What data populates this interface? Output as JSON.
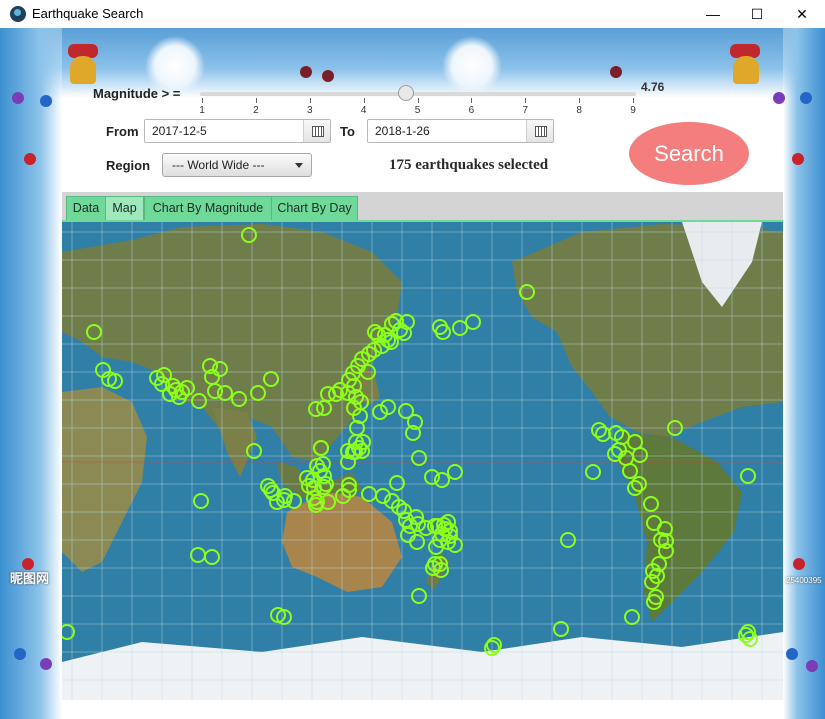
{
  "window": {
    "title": "Earthquake Search",
    "minimize": "—",
    "maximize": "☐",
    "close": "✕"
  },
  "controls": {
    "magnitude_label": "Magnitude > =",
    "magnitude_value": "4.76",
    "magnitude_min": 1,
    "magnitude_max": 9,
    "tick_labels": [
      "1",
      "2",
      "3",
      "4",
      "5",
      "6",
      "7",
      "8",
      "9"
    ],
    "from_label": "From",
    "from_date": "2017-12-5",
    "to_label": "To",
    "to_date": "2018-1-26",
    "region_label": "Region",
    "region_value": "--- World Wide ---",
    "count_text": "175 earthquakes selected",
    "search_label": "Search"
  },
  "tabs": [
    {
      "label": "Data",
      "active": false
    },
    {
      "label": "Map",
      "active": true
    },
    {
      "label": "Chart By Magnitude",
      "active": false
    },
    {
      "label": "Chart By Day",
      "active": false
    }
  ],
  "decor": {
    "left_stamp": "昵图网",
    "right_stamp": "25400395"
  },
  "colors": {
    "search_button": "#f47d7d",
    "tab": "#6fd99a",
    "quake_marker": "#8cff1a",
    "ocean": "#2f7fa6"
  },
  "map": {
    "projection": "Pacific-centered equirectangular",
    "marker_count": 175
  }
}
